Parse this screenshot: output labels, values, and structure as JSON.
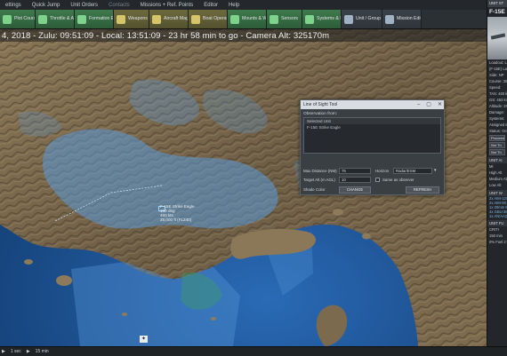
{
  "menubar": {
    "items": [
      "ettings",
      "Quick Jump",
      "Unit Orders",
      "Contacts",
      "Missions + Ref. Points",
      "Editor",
      "Help"
    ]
  },
  "toolbar": {
    "buttons": [
      {
        "label": "Plot Course",
        "style": "green"
      },
      {
        "label": "Throttle & Altitude",
        "style": "green"
      },
      {
        "label": "Formation Editor",
        "style": "green"
      },
      {
        "label": "Weapons",
        "style": "olive"
      },
      {
        "label": "Aircraft Magazines",
        "style": "olive"
      },
      {
        "label": "Boat Operations",
        "style": "olive"
      },
      {
        "label": "Mounts & Weapons",
        "style": "green"
      },
      {
        "label": "Sensors",
        "style": "green"
      },
      {
        "label": "Systems & Damage",
        "style": "green"
      },
      {
        "label": "Unit / Group Doctrine",
        "style": "slate"
      },
      {
        "label": "Mission Editor",
        "style": "slate"
      }
    ]
  },
  "time_strip": {
    "text": "4, 2018 - Zulu: 09:51:09 - Local: 13:51:09 - 23 hr 58 min to go -  Camera Alt: 325170m"
  },
  "map": {
    "unit": {
      "name": "F-15E Strike Eagle",
      "lines": [
        "F-15E Strike Eagle",
        "150 deg",
        "460 kts",
        "25,000 ft (FL240)"
      ]
    },
    "compass_glyph": "✦"
  },
  "dialog": {
    "title": "Line of Sight Tool",
    "window_buttons": [
      "–",
      "▢",
      "✕"
    ],
    "observation_label": "Observation from:",
    "list_header": "Selected Unit",
    "list_items": [
      "F-15E Strike Eagle"
    ],
    "max_distance_label": "Max Distance (NM)",
    "max_distance_value": "75",
    "horizon_label": "Horizon",
    "horizon_value": "Radar/ESM",
    "target_alt_label": "Target Alt (m AGL)",
    "target_alt_value": "10",
    "same_as_observer_label": "Same as observer",
    "shade_color_label": "Shade Color",
    "change_button": "CHANGE",
    "refresh_button": "REFRESH"
  },
  "right_panel": {
    "header": "UNIT ST",
    "unit_title": "F-15E St",
    "lines": [
      "Loadout: Li",
      "(F-15E) Lan",
      "Side: NP",
      "Course: 25",
      "Speed:",
      "TAS: 460 kn",
      "GS: 453 kn",
      "Altitude: 25",
      "Damage:",
      "Systems:",
      "Assigned to",
      "Status: On"
    ],
    "sections": [
      {
        "title": "UNIT AI",
        "items": [
          "Mi",
          "High Alt",
          "Medium Alt",
          "Low Alt"
        ]
      },
      {
        "title": "UNIT W",
        "links": [
          "2x AIM-120",
          "2x AIM-9X",
          "1x 20mm M",
          "4x GBU-38",
          "1x AN/AAQ"
        ]
      },
      {
        "title": "UNIT FU",
        "items": [
          "CRITI",
          "150 min",
          "0% Fuel 2"
        ]
      }
    ],
    "button_labels": [
      "Proceed N",
      "Set Th",
      "Set Th"
    ]
  },
  "bottombar": {
    "items": [
      "▶",
      "1 sec",
      "▶",
      "15 min"
    ]
  },
  "colors": {
    "accent_green": "#3f7a4c",
    "accent_olive": "#6d6a3d",
    "ocean": "#1d4e8f",
    "coverage": "#4d8fd6",
    "terrain": "#7a6a52"
  }
}
